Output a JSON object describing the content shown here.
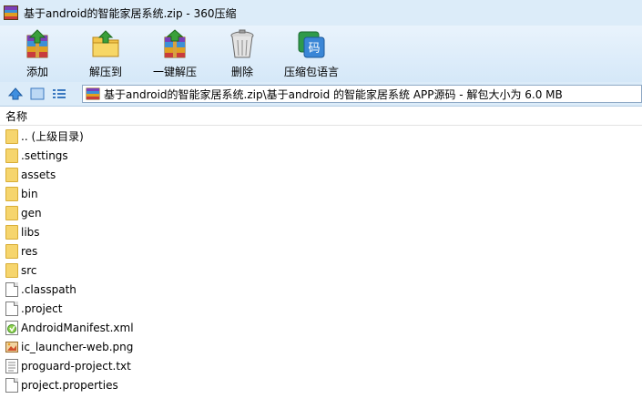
{
  "window": {
    "title": "基于android的智能家居系统.zip - 360压缩"
  },
  "toolbar": {
    "items": [
      {
        "label": "添加",
        "icon": "add-archive-icon"
      },
      {
        "label": "解压到",
        "icon": "extract-to-icon"
      },
      {
        "label": "一键解压",
        "icon": "one-click-extract-icon"
      },
      {
        "label": "删除",
        "icon": "trash-can-icon"
      },
      {
        "label": "压缩包语言",
        "icon": "archive-language-icon",
        "icon_text": "码"
      }
    ]
  },
  "address": {
    "path": "基于android的智能家居系统.zip\\基于android 的智能家居系统 APP源码 - 解包大小为 6.0 MB"
  },
  "list": {
    "column_name": "名称",
    "items": [
      {
        "name": ".. (上级目录)",
        "type": "folder"
      },
      {
        "name": ".settings",
        "type": "folder"
      },
      {
        "name": "assets",
        "type": "folder"
      },
      {
        "name": "bin",
        "type": "folder"
      },
      {
        "name": "gen",
        "type": "folder"
      },
      {
        "name": "libs",
        "type": "folder"
      },
      {
        "name": "res",
        "type": "folder"
      },
      {
        "name": "src",
        "type": "folder"
      },
      {
        "name": ".classpath",
        "type": "file"
      },
      {
        "name": ".project",
        "type": "file"
      },
      {
        "name": "AndroidManifest.xml",
        "type": "xml"
      },
      {
        "name": "ic_launcher-web.png",
        "type": "image"
      },
      {
        "name": "proguard-project.txt",
        "type": "text"
      },
      {
        "name": "project.properties",
        "type": "file"
      }
    ]
  },
  "colors": {
    "accent": "#dcecf9",
    "folder": "#f6d56d"
  }
}
